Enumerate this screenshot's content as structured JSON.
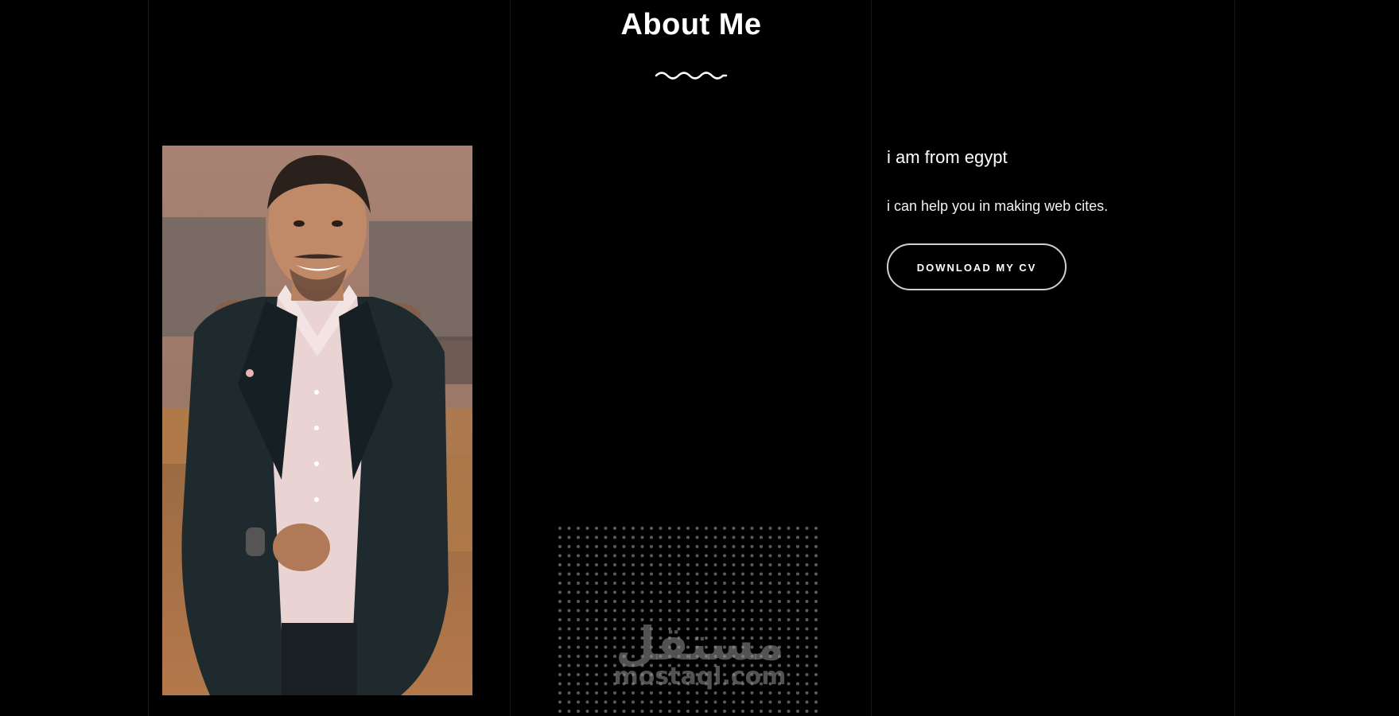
{
  "about": {
    "title": "About Me",
    "origin_text": "i am from egypt",
    "help_text": "i can help you in making web cites.",
    "download_cv_label": "DOWNLOAD MY CV"
  },
  "watermark": {
    "arabic": "مستقل",
    "latin": "mostaql.com"
  },
  "colors": {
    "background": "#000000",
    "text": "#ffffff",
    "button_border": "#cfcfcf",
    "grid_line": "#1a1a1a"
  }
}
